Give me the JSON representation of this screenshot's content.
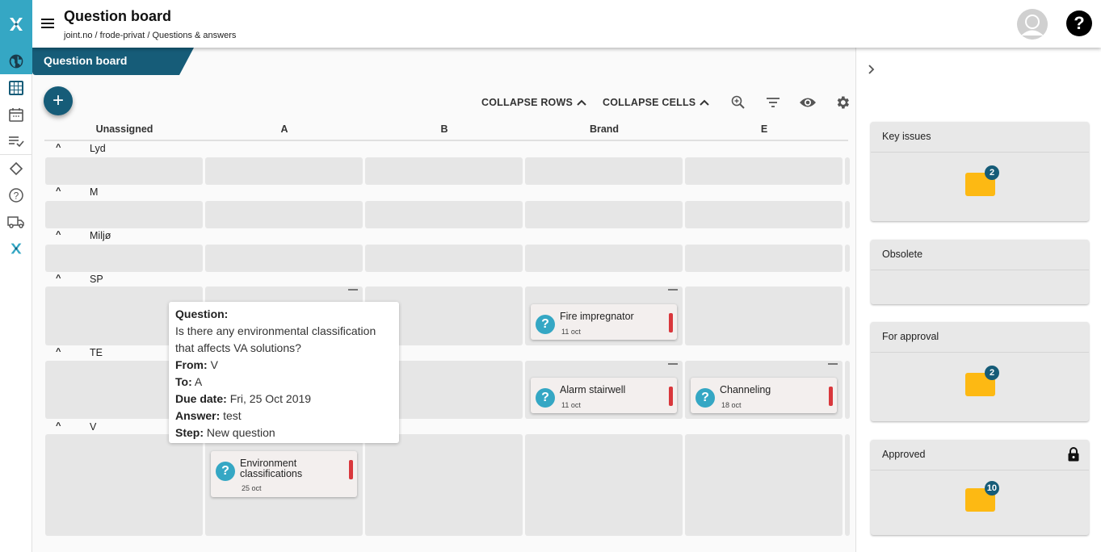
{
  "app": {
    "title": "Question board",
    "breadcrumb": "joint.no / frode-privat / Questions & answers",
    "tab_label": "Question board"
  },
  "rail": {
    "items": [
      "logo-icon",
      "globe-icon",
      "grid-icon",
      "calendar-icon",
      "checklist-icon",
      "diamond-icon",
      "help-circle-icon",
      "truck-icon",
      "joint-icon"
    ],
    "active": "globe-icon"
  },
  "toolbar": {
    "add_label": "+",
    "collapse_rows": "COLLAPSE ROWS",
    "collapse_cells": "COLLAPSE CELLS",
    "icons": [
      "zoom-in-icon",
      "filter-icon",
      "eye-icon",
      "settings-icon"
    ]
  },
  "columns": [
    "Unassigned",
    "A",
    "B",
    "Brand",
    "E"
  ],
  "rows": [
    {
      "name": "Lyd"
    },
    {
      "name": "M"
    },
    {
      "name": "Miljø"
    },
    {
      "name": "SP"
    },
    {
      "name": "TE"
    },
    {
      "name": "V"
    }
  ],
  "cards": [
    {
      "title": "Fire impregnator",
      "date": "11 oct",
      "row": "SP",
      "column": "Brand"
    },
    {
      "title": "Alarm stairwell",
      "date": "11 oct",
      "row": "TE",
      "column": "Brand"
    },
    {
      "title": "Channeling",
      "date": "18 oct",
      "row": "TE",
      "column": "E"
    },
    {
      "title": "Environment classifications",
      "date": "25 oct",
      "row": "V",
      "column": "A"
    }
  ],
  "tooltip": {
    "question_label": "Question:",
    "question": "Is there any environmental classification that affects VA solutions?",
    "from_label": "From:",
    "from": "V",
    "to_label": "To:",
    "to": "A",
    "due_label": "Due date:",
    "due": "Fri, 25 Oct 2019",
    "answer_label": "Answer:",
    "answer": "test",
    "step_label": "Step:",
    "step": "New question"
  },
  "side_panels": [
    {
      "title": "Key issues",
      "count": "2"
    },
    {
      "title": "Obsolete",
      "count": null
    },
    {
      "title": "For approval",
      "count": "2"
    },
    {
      "title": "Approved",
      "count": "10",
      "locked": true
    }
  ],
  "colors": {
    "brand_dark": "#165c78",
    "brand_light": "#35a7c4",
    "priority": "#d9373c",
    "folder": "#fdb913"
  }
}
